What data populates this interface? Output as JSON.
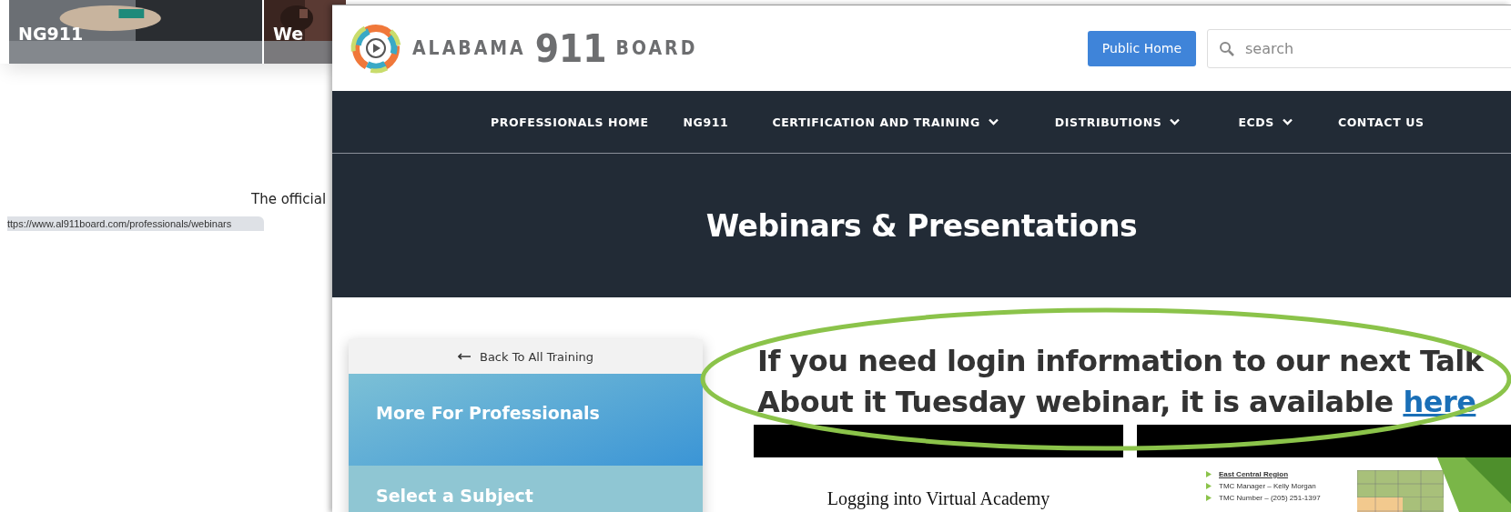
{
  "background_page": {
    "tiles": [
      {
        "label": "NG911",
        "kind": "picture"
      },
      {
        "label": "We",
        "kind": "picture"
      }
    ],
    "text": "The official",
    "status_url": "ttps://www.al911board.com/professionals/webinars"
  },
  "header": {
    "logo": {
      "word_1": "ALABAMA",
      "word_2": "911",
      "word_3": "BOARD"
    },
    "button": "Public Home",
    "search": {
      "placeholder": "search"
    }
  },
  "nav": [
    {
      "label": "PROFESSIONALS HOME",
      "dropdown": false
    },
    {
      "label": "NG911",
      "dropdown": false
    },
    {
      "label": "CERTIFICATION AND TRAINING",
      "dropdown": true
    },
    {
      "label": "DISTRIBUTIONS",
      "dropdown": true
    },
    {
      "label": "ECDS",
      "dropdown": true
    },
    {
      "label": "CONTACT US",
      "dropdown": false
    }
  ],
  "hero": {
    "title": "Webinars & Presentations"
  },
  "sidebar": {
    "back_link": "Back To All Training",
    "items": [
      {
        "label": "More For Professionals",
        "selected": true
      },
      {
        "label": "Select a Subject",
        "selected": false
      }
    ]
  },
  "content": {
    "heading": "If you need login information to our next Talk About it Tuesday webinar, it is available",
    "heading_link": "here",
    "highlighted": true,
    "cards": [
      {
        "kind": "title",
        "title": "Logging into Virtual Academy"
      },
      {
        "kind": "map",
        "bullets": [
          "East Central Region",
          "TMC Manager – Kelly Morgan",
          "TMC Number – (205) 251-1397"
        ]
      }
    ]
  }
}
